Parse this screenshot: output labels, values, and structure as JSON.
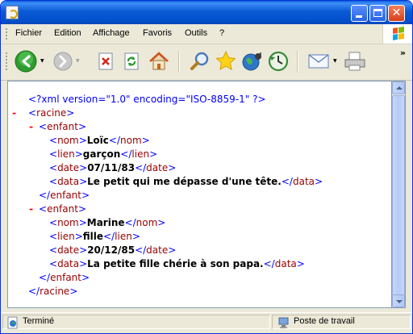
{
  "menubar": {
    "items": [
      {
        "id": "fichier",
        "label": "Fichier"
      },
      {
        "id": "edition",
        "label": "Edition"
      },
      {
        "id": "affichage",
        "label": "Affichage"
      },
      {
        "id": "favoris",
        "label": "Favoris"
      },
      {
        "id": "outils",
        "label": "Outils"
      },
      {
        "id": "aide",
        "label": "?"
      }
    ]
  },
  "toolbar": {
    "overflow_label": "»",
    "icons": [
      "back-icon",
      "forward-icon",
      "stop-icon",
      "refresh-icon",
      "home-icon",
      "search-icon",
      "favorites-icon",
      "media-icon",
      "history-icon",
      "mail-icon",
      "print-icon"
    ]
  },
  "xml": {
    "declaration": "<?xml version=\"1.0\" encoding=\"ISO-8859-1\" ?>",
    "root_tag": "racine",
    "entries": [
      {
        "tag": "enfant",
        "fields": [
          {
            "tag": "nom",
            "value": "Loïc"
          },
          {
            "tag": "lien",
            "value": "garçon"
          },
          {
            "tag": "date",
            "value": "07/11/83"
          },
          {
            "tag": "data",
            "value": "Le petit qui me dépasse d'une tête."
          }
        ]
      },
      {
        "tag": "enfant",
        "fields": [
          {
            "tag": "nom",
            "value": "Marine"
          },
          {
            "tag": "lien",
            "value": "fille"
          },
          {
            "tag": "date",
            "value": "20/12/85"
          },
          {
            "tag": "data",
            "value": "La petite fille chérie à son papa."
          }
        ]
      }
    ],
    "collapse_glyph": "-"
  },
  "statusbar": {
    "status_text": "Terminé",
    "zone_text": "Poste de travail"
  },
  "colors": {
    "titlebar": "#0a5ad6",
    "tag_name": "#990000",
    "bracket": "#0000ff",
    "collapse_minus": "#ff0000"
  }
}
